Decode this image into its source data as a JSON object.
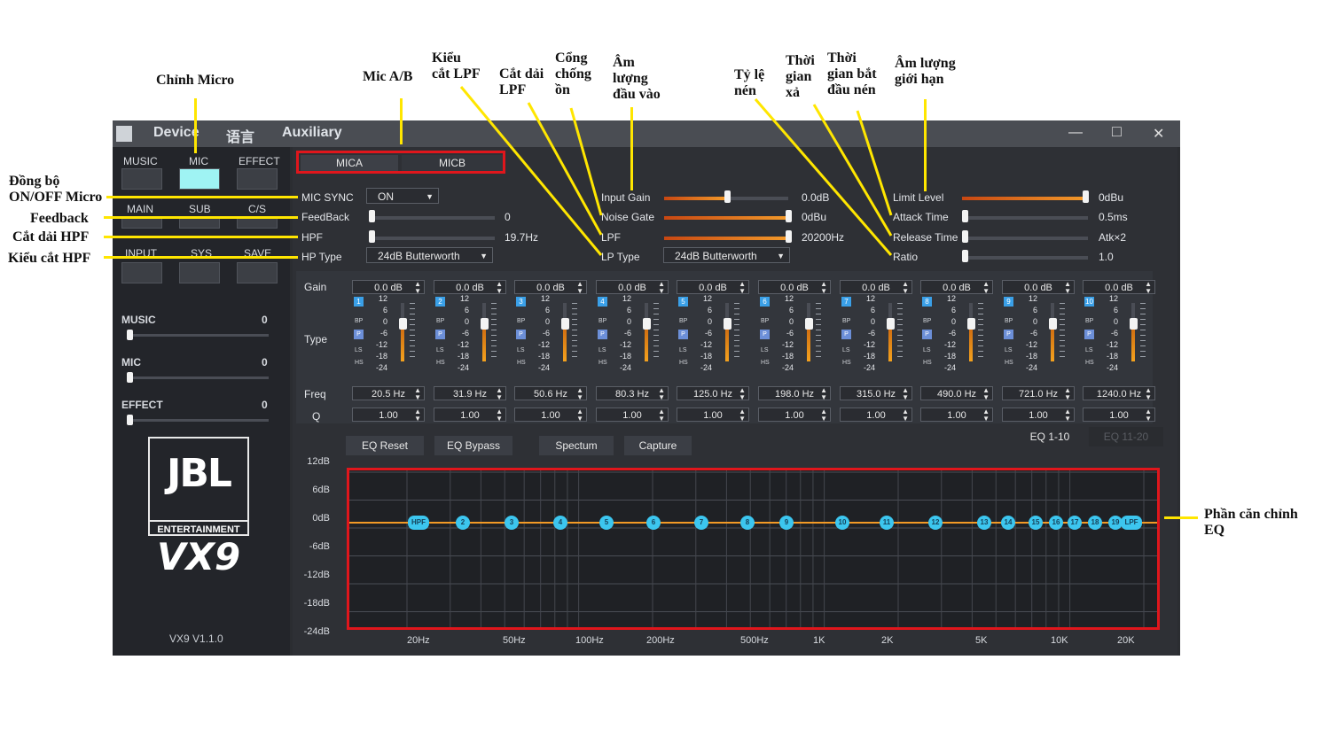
{
  "annotations": {
    "chinh_micro": "Chỉnh Micro",
    "mic_ab": "Mic A/B",
    "kieu_cat_lpf_1": "Kiểu",
    "kieu_cat_lpf_2": "cắt LPF",
    "cat_dai_lpf_1": "Cắt dải",
    "cat_dai_lpf_2": "LPF",
    "cong_chong_on_1": "Cổng",
    "cong_chong_on_2": "chống",
    "cong_chong_on_3": "ồn",
    "am_luong_dau_vao_1": "Âm",
    "am_luong_dau_vao_2": "lượng",
    "am_luong_dau_vao_3": "đầu vào",
    "ty_le_nen_1": "Tỷ lệ",
    "ty_le_nen_2": "nén",
    "thoi_gian_xa_1": "Thời",
    "thoi_gian_xa_2": "gian",
    "thoi_gian_xa_3": "xả",
    "thoi_gian_bat_dau_nen_1": "Thời",
    "thoi_gian_bat_dau_nen_2": "gian bắt",
    "thoi_gian_bat_dau_nen_3": "đầu nén",
    "am_luong_gioi_han_1": "Âm lượng",
    "am_luong_gioi_han_2": "giới hạn",
    "dong_bo_1": "Đồng bộ",
    "dong_bo_2": "ON/OFF Micro",
    "feedback": "Feedback",
    "cat_dai_hpf": "Cắt dải HPF",
    "kieu_cat_hpf": "Kiểu cắt HPF",
    "phan_can_chinh_1": "Phần căn chỉnh",
    "phan_can_chinh_2": "EQ"
  },
  "titlebar": {
    "menu": [
      "Device",
      "语言",
      "Auxiliary"
    ],
    "minimize": "—",
    "maximize": "□",
    "close": "✕"
  },
  "left": {
    "tabs_row1": [
      "MUSIC",
      "MIC",
      "EFFECT"
    ],
    "tabs_row2": [
      "MAIN",
      "SUB",
      "C/S"
    ],
    "tabs_row3": [
      "INPUT",
      "SYS",
      "SAVE"
    ],
    "sliders": [
      {
        "label": "MUSIC",
        "value": "0"
      },
      {
        "label": "MIC",
        "value": "0"
      },
      {
        "label": "EFFECT",
        "value": "0"
      }
    ],
    "logo_brand": "JBL",
    "logo_sub": "ENTERTAINMENT",
    "logo_model": "VX9",
    "version": "VX9 V1.1.0"
  },
  "mic_tabs": [
    "MICA",
    "MICB"
  ],
  "controls": {
    "mic_sync": {
      "label": "MIC SYNC",
      "value": "ON"
    },
    "feedback": {
      "label": "FeedBack",
      "value": "0",
      "level": 0.0
    },
    "hpf": {
      "label": "HPF",
      "value": "19.7Hz",
      "level": 0.0
    },
    "hp_type": {
      "label": "HP Type",
      "value": "24dB Butterworth"
    },
    "input_gain": {
      "label": "Input Gain",
      "value": "0.0dB",
      "level": 0.5
    },
    "noise_gate": {
      "label": "Noise Gate",
      "value": "0dBu",
      "level": 1.0
    },
    "lpf": {
      "label": "LPF",
      "value": "20200Hz",
      "level": 1.0
    },
    "lp_type": {
      "label": "LP Type",
      "value": "24dB Butterworth"
    },
    "limit_level": {
      "label": "Limit Level",
      "value": "0dBu",
      "level": 1.0
    },
    "attack_time": {
      "label": "Attack Time",
      "value": "0.5ms",
      "level": 0.0
    },
    "release_time": {
      "label": "Release Time",
      "value": "Atk×2",
      "level": 0.0
    },
    "ratio": {
      "label": "Ratio",
      "value": "1.0",
      "level": 0.0
    }
  },
  "eq": {
    "row_labels": {
      "gain": "Gain",
      "type": "Type",
      "freq": "Freq",
      "q": "Q"
    },
    "scale": [
      "12",
      "6",
      "0",
      "-6",
      "-12",
      "-18",
      "-24"
    ],
    "type_labels": [
      "BP",
      "P",
      "LS",
      "HS"
    ],
    "bands": [
      {
        "n": "1",
        "gain": "0.0 dB",
        "freq": "20.5 Hz",
        "q": "1.00"
      },
      {
        "n": "2",
        "gain": "0.0 dB",
        "freq": "31.9 Hz",
        "q": "1.00"
      },
      {
        "n": "3",
        "gain": "0.0 dB",
        "freq": "50.6 Hz",
        "q": "1.00"
      },
      {
        "n": "4",
        "gain": "0.0 dB",
        "freq": "80.3 Hz",
        "q": "1.00"
      },
      {
        "n": "5",
        "gain": "0.0 dB",
        "freq": "125.0 Hz",
        "q": "1.00"
      },
      {
        "n": "6",
        "gain": "0.0 dB",
        "freq": "198.0 Hz",
        "q": "1.00"
      },
      {
        "n": "7",
        "gain": "0.0 dB",
        "freq": "315.0 Hz",
        "q": "1.00"
      },
      {
        "n": "8",
        "gain": "0.0 dB",
        "freq": "490.0 Hz",
        "q": "1.00"
      },
      {
        "n": "9",
        "gain": "0.0 dB",
        "freq": "721.0 Hz",
        "q": "1.00"
      },
      {
        "n": "10",
        "gain": "0.0 dB",
        "freq": "1240.0 Hz",
        "q": "1.00"
      }
    ],
    "buttons": [
      "EQ Reset",
      "EQ Bypass",
      "Spectum",
      "Capture"
    ],
    "pages": [
      "EQ 1-10",
      "EQ 11-20"
    ]
  },
  "graph": {
    "y_labels": [
      "12dB",
      "6dB",
      "0dB",
      "-6dB",
      "-12dB",
      "-18dB",
      "-24dB"
    ],
    "x_labels": [
      "20Hz",
      "50Hz",
      "100Hz",
      "200Hz",
      "500Hz",
      "1K",
      "2K",
      "5K",
      "10K",
      "20K"
    ],
    "nodes": [
      "HPF",
      "2",
      "3",
      "4",
      "5",
      "6",
      "7",
      "8",
      "9",
      "10",
      "11",
      "12",
      "13",
      "14",
      "15",
      "16",
      "17",
      "18",
      "19",
      "LPF"
    ]
  },
  "colors": {
    "accent": "#3cc6ef",
    "curve": "#f29a26",
    "highlight_box": "#e0161c",
    "annotation_line": "#ffe600"
  }
}
